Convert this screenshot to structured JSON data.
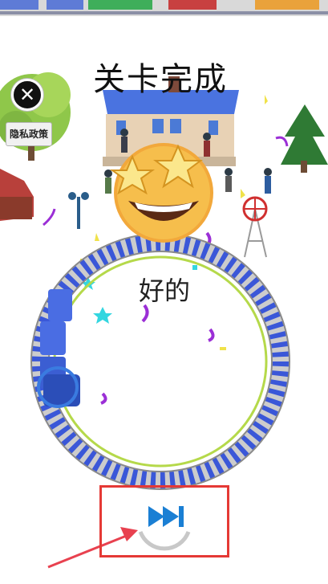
{
  "title": "关卡完成",
  "privacy_button_label": "隐私政策",
  "ok_label": "好的",
  "icons": {
    "close": "close-icon",
    "skip": "fast-forward-icon",
    "emoji": "star-struck-emoji",
    "pointer": "arrow-pointer"
  },
  "colors": {
    "track_blue": "#3a57d8",
    "highlight_red": "#e53935",
    "skip_blue": "#1a7fd4"
  }
}
